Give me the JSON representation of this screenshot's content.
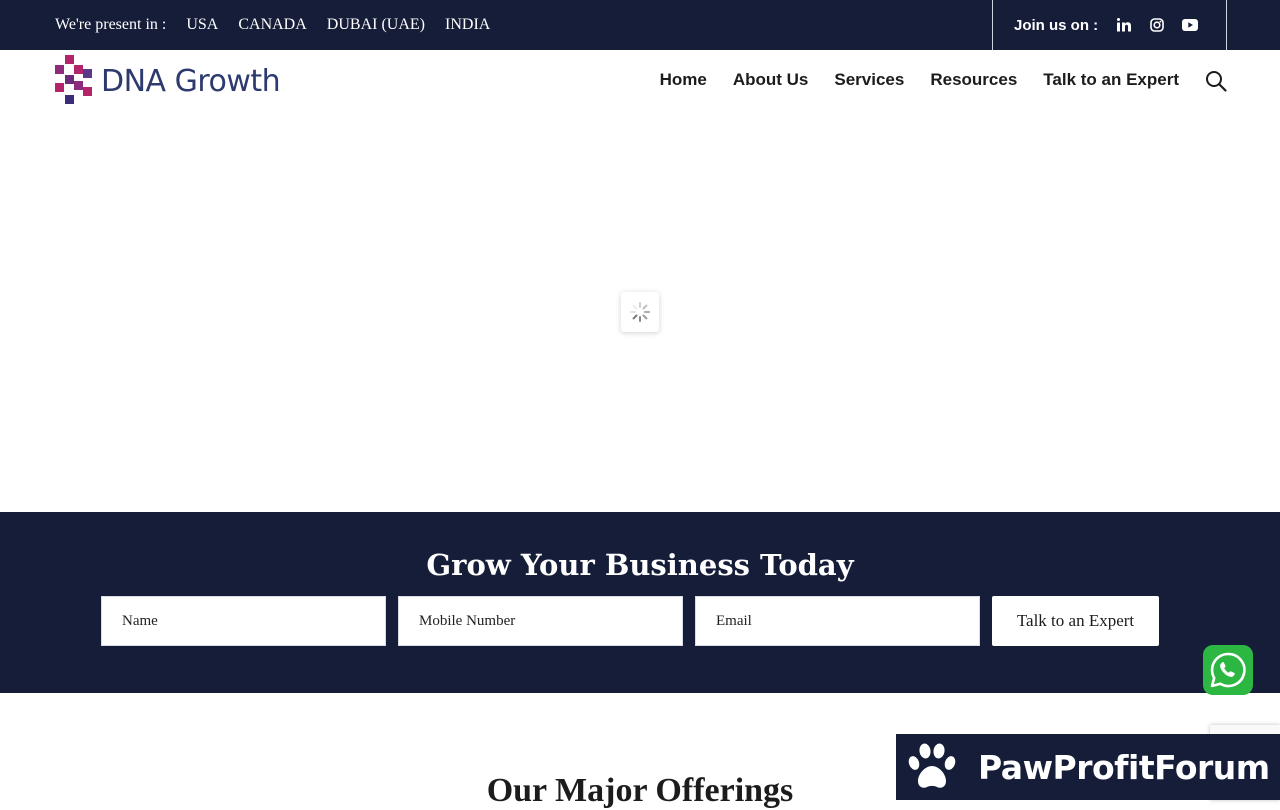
{
  "topbar": {
    "present_label": "We're present in :",
    "countries": [
      "USA",
      "CANADA",
      "DUBAI (UAE)",
      "INDIA"
    ],
    "join_label": "Join us on :",
    "social": [
      "linkedin-icon",
      "instagram-icon",
      "youtube-icon"
    ]
  },
  "header": {
    "logo_text": "DNA Growth",
    "nav": [
      "Home",
      "About Us",
      "Services",
      "Resources",
      "Talk to an Expert"
    ]
  },
  "grow": {
    "title": "Grow Your Business Today",
    "name_placeholder": "Name",
    "mobile_placeholder": "Mobile Number",
    "email_placeholder": "Email",
    "button_label": "Talk to an Expert"
  },
  "offerings": {
    "title": "Our Major Offerings"
  },
  "watermark": {
    "text": "PawProfitForum"
  },
  "colors": {
    "navy": "#161d38",
    "whatsapp": "#2bb741",
    "logo_purple": "#6b2a7a",
    "logo_magenta": "#b4246a"
  }
}
